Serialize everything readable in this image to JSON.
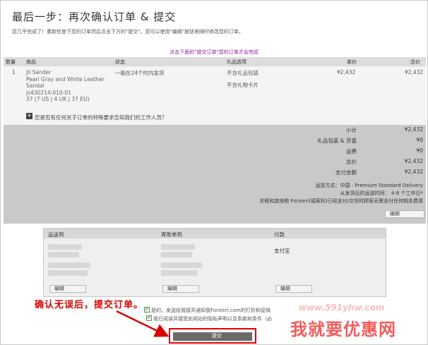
{
  "header": {
    "title": "最后一步：再次确认订单 & 提交",
    "subtitle": "您几乎完成了！重新检查下您的订单然后点击下方的\"提交\"。您可以使用\"编辑\"按钮来随时修改您的订单。"
  },
  "banner": "点击下面的\"提交订单\"您的订单才会完成",
  "table": {
    "columns": [
      "数量",
      "商品",
      "状态",
      "礼品选项",
      "单价",
      "总价"
    ],
    "item": {
      "qty": "1",
      "brand": "Jil Sander",
      "name_line1": "Pearl Gray and White Leather",
      "name_line2": "Sandal",
      "sku": "js430214-010-01",
      "size": "37 (7 US | 4 UK | 37 EU)",
      "status": "一般在24个时内发货",
      "gift_option1": "不含礼品包装",
      "gift_option2": "不含礼物卡片",
      "unit_price": "¥2,432",
      "total_price": "¥2,432"
    },
    "special_request": "您是否有任何关于订单的特殊要求告知我们的工作人员？"
  },
  "totals": {
    "rows": [
      {
        "label": "小计",
        "value": "¥2,432"
      },
      {
        "label": "礼品包装 & 芳香",
        "value": "¥0"
      },
      {
        "label": "运费",
        "value": "¥0"
      },
      {
        "label": "总价",
        "value": "¥2,432"
      },
      {
        "label": "支付金额",
        "value": "¥2,432"
      }
    ],
    "shipping_method": "运送方式：中国 - Premium Standard Delivery",
    "shipping_time": "从发货后的运送时间： 4-8 个工作日*",
    "customs_note": "关税和其他税 Forzieri(福客利)已经支付/交货时顾客无需支付任何相关费用",
    "edit_label": "编辑"
  },
  "address": {
    "ship_to": "运送到",
    "bill_to": "寄账单到",
    "payment": "付款",
    "payment_method": "支付宝",
    "edit_label": "编辑"
  },
  "callout": "确认无误后，提交订单。",
  "consent": {
    "line1": "是的，发送给我接并通知我Forzieri.com的打折和促销",
    "line2": "我已阅读并接受此网站的隐私声明以及条款和条件（必"
  },
  "submit_label": "提交",
  "watermark": {
    "url": "www.591yhw.com",
    "text": "我就要优惠网"
  },
  "colors": {
    "accent": "#8a1a9a",
    "callout": "#d80000",
    "submit_bg": "#6a6a6a"
  }
}
